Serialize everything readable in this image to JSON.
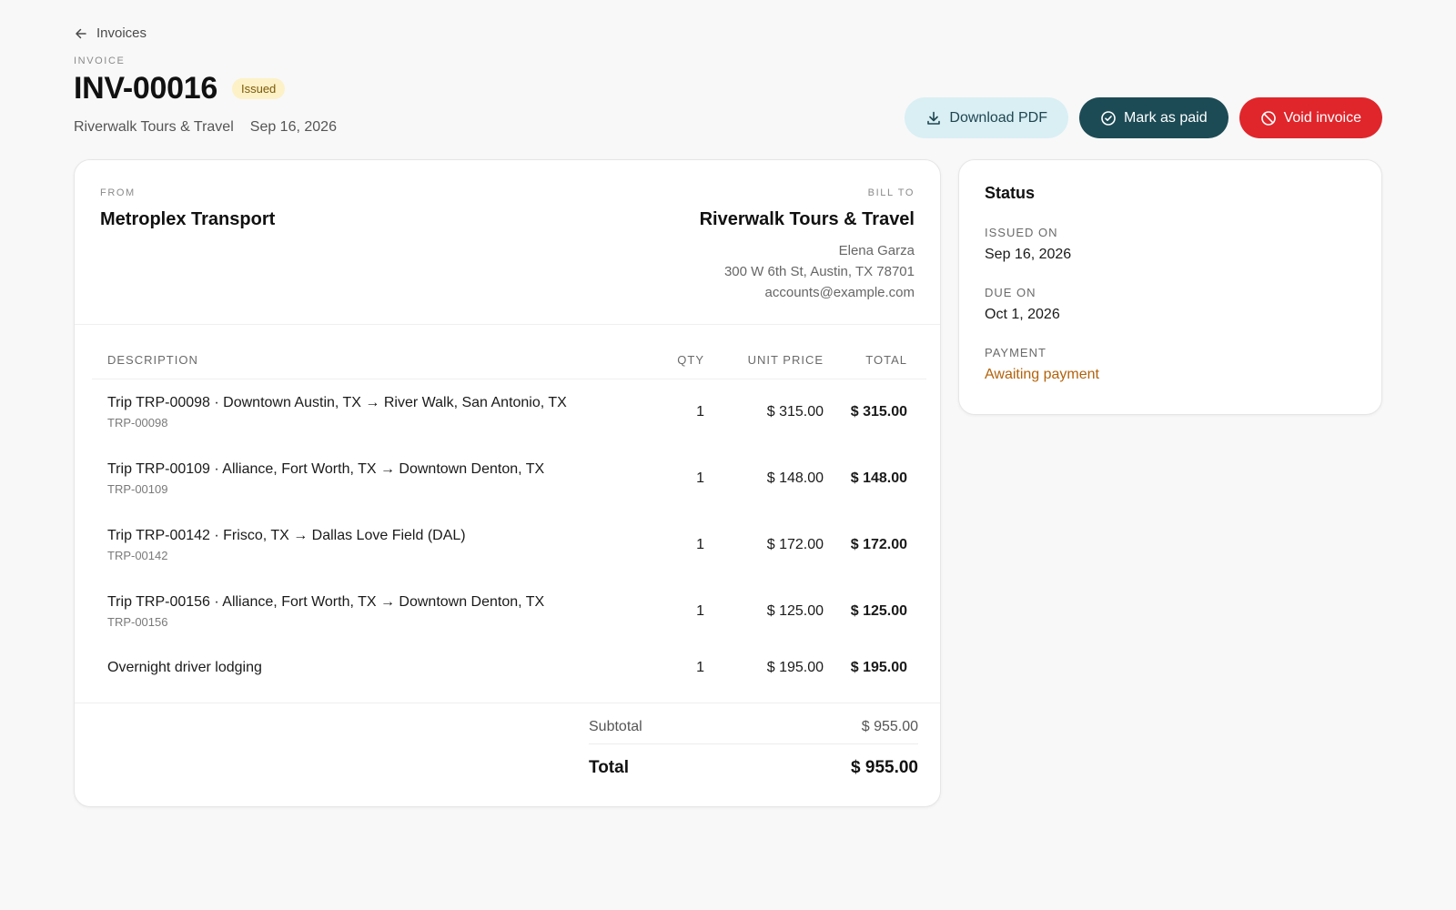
{
  "nav": {
    "back_label": "Invoices"
  },
  "header": {
    "eyebrow": "INVOICE",
    "invoice_number": "INV-00016",
    "status_badge": "Issued",
    "customer": "Riverwalk Tours & Travel",
    "date": "Sep 16, 2026"
  },
  "actions": {
    "download_label": "Download PDF",
    "mark_paid_label": "Mark as paid",
    "void_label": "Void invoice"
  },
  "invoice": {
    "from_label": "FROM",
    "from_name": "Metroplex Transport",
    "bill_to_label": "BILL TO",
    "bill_to_name": "Riverwalk Tours & Travel",
    "bill_to_contact": "Elena Garza",
    "bill_to_address": "300 W 6th St, Austin, TX 78701",
    "bill_to_email": "accounts@example.com",
    "columns": {
      "description": "DESCRIPTION",
      "qty": "QTY",
      "unit_price": "UNIT PRICE",
      "total": "TOTAL"
    },
    "items": [
      {
        "description": "Trip TRP-00098 · Downtown Austin, TX → River Walk, San Antonio, TX",
        "ref": "TRP-00098",
        "qty": "1",
        "unit_price": "$ 315.00",
        "total": "$ 315.00"
      },
      {
        "description": "Trip TRP-00109 · Alliance, Fort Worth, TX → Downtown Denton, TX",
        "ref": "TRP-00109",
        "qty": "1",
        "unit_price": "$ 148.00",
        "total": "$ 148.00"
      },
      {
        "description": "Trip TRP-00142 · Frisco, TX → Dallas Love Field (DAL)",
        "ref": "TRP-00142",
        "qty": "1",
        "unit_price": "$ 172.00",
        "total": "$ 172.00"
      },
      {
        "description": "Trip TRP-00156 · Alliance, Fort Worth, TX → Downtown Denton, TX",
        "ref": "TRP-00156",
        "qty": "1",
        "unit_price": "$ 125.00",
        "total": "$ 125.00"
      },
      {
        "description": "Overnight driver lodging",
        "ref": "",
        "qty": "1",
        "unit_price": "$ 195.00",
        "total": "$ 195.00"
      }
    ],
    "subtotal_label": "Subtotal",
    "subtotal_value": "$ 955.00",
    "total_label": "Total",
    "total_value": "$ 955.00"
  },
  "status_panel": {
    "title": "Status",
    "issued_on_label": "ISSUED ON",
    "issued_on_value": "Sep 16, 2026",
    "due_on_label": "DUE ON",
    "due_on_value": "Oct 1, 2026",
    "payment_label": "PAYMENT",
    "payment_value": "Awaiting payment"
  },
  "colors": {
    "badge_bg": "#fdf1c7",
    "download_bg": "#d9eff4",
    "mark_paid_bg": "#1c4b55",
    "void_bg": "#e0262b",
    "payment_warn": "#b3620a"
  },
  "icons": {
    "back": "arrow-left-icon",
    "download": "download-icon",
    "mark_paid": "check-circle-icon",
    "void": "ban-icon"
  }
}
